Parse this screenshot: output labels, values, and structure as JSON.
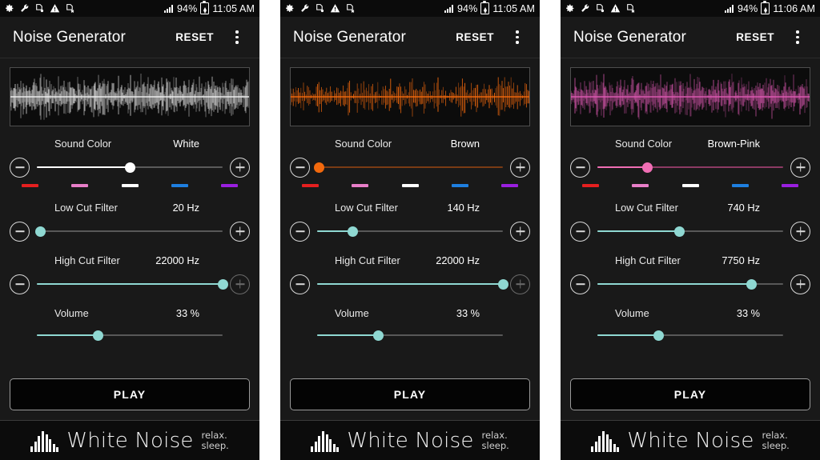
{
  "colors": {
    "accent_teal": "#8fd8d2",
    "track_off": "#585858",
    "bg_panel": "#191919",
    "bg_statusbar": "#0b0b0b",
    "brand_bar": "#0c0c0c",
    "sound_white": "#ffffff",
    "sound_brown": "#f2690d",
    "sound_brownpink": "#f06eb4"
  },
  "swatches": [
    {
      "name": "red",
      "color": "#e51f1f",
      "pos": 6
    },
    {
      "name": "pink",
      "color": "#e87ec8",
      "pos": 28
    },
    {
      "name": "white",
      "color": "#ffffff",
      "pos": 50
    },
    {
      "name": "blue",
      "color": "#1e7fe0",
      "pos": 72
    },
    {
      "name": "violet",
      "color": "#9a1fe0",
      "pos": 94
    }
  ],
  "labels": {
    "sound_color": "Sound Color",
    "low_cut": "Low Cut Filter",
    "high_cut": "High Cut Filter",
    "volume": "Volume",
    "play": "PLAY",
    "reset": "RESET",
    "app_title": "Noise Generator"
  },
  "brand": {
    "name": "White Noise",
    "tag_line1": "relax.",
    "tag_line2": "sleep."
  },
  "status_icons": [
    "gear-icon",
    "wrench-icon",
    "document-sync-icon",
    "warning-triangle-icon",
    "document-error-icon"
  ],
  "panels": [
    {
      "status": {
        "battery_pct": "94%",
        "time": "11:05 AM"
      },
      "title": "Noise Generator",
      "reset": "RESET",
      "waveform": {
        "color": "#f2f2f2",
        "seed": 11,
        "density": 1.0,
        "amp": 0.72,
        "smooth": 1
      },
      "sound_color": {
        "label": "Sound Color",
        "value": "White",
        "pos": 50,
        "fill_color": "#ffffff",
        "thumb_color": "#ffffff",
        "track_color": "#5a5a5a",
        "minus_enabled": true,
        "plus_enabled": true
      },
      "low_cut": {
        "label": "Low Cut Filter",
        "value": "20 Hz",
        "pos": 2,
        "minus_enabled": true,
        "plus_enabled": true
      },
      "high_cut": {
        "label": "High Cut Filter",
        "value": "22000 Hz",
        "pos": 100,
        "minus_enabled": true,
        "plus_enabled": false
      },
      "volume": {
        "label": "Volume",
        "value": "33 %",
        "pos": 33
      },
      "play": "PLAY"
    },
    {
      "status": {
        "battery_pct": "94%",
        "time": "11:05 AM"
      },
      "title": "Noise Generator",
      "reset": "RESET",
      "waveform": {
        "color": "#f2690d",
        "seed": 29,
        "density": 0.55,
        "amp": 0.62,
        "smooth": 2
      },
      "sound_color": {
        "label": "Sound Color",
        "value": "Brown",
        "pos": 1,
        "fill_color": "#f2690d",
        "thumb_color": "#f2690d",
        "track_color": "#7a3b14",
        "minus_enabled": true,
        "plus_enabled": true
      },
      "low_cut": {
        "label": "Low Cut Filter",
        "value": "140 Hz",
        "pos": 19,
        "minus_enabled": true,
        "plus_enabled": true
      },
      "high_cut": {
        "label": "High Cut Filter",
        "value": "22000 Hz",
        "pos": 100,
        "minus_enabled": true,
        "plus_enabled": false
      },
      "volume": {
        "label": "Volume",
        "value": "33 %",
        "pos": 33
      },
      "play": "PLAY"
    },
    {
      "status": {
        "battery_pct": "94%",
        "time": "11:06 AM"
      },
      "title": "Noise Generator",
      "reset": "RESET",
      "waveform": {
        "color": "#e05ab4",
        "seed": 47,
        "density": 0.85,
        "amp": 0.7,
        "smooth": 1
      },
      "sound_color": {
        "label": "Sound Color",
        "value": "Brown-Pink",
        "pos": 27,
        "fill_color": "#f06eb4",
        "thumb_color": "#f06eb4",
        "track_color": "#8c3a63",
        "minus_enabled": true,
        "plus_enabled": true
      },
      "low_cut": {
        "label": "Low Cut Filter",
        "value": "740 Hz",
        "pos": 44,
        "minus_enabled": true,
        "plus_enabled": true
      },
      "high_cut": {
        "label": "High Cut Filter",
        "value": "7750 Hz",
        "pos": 83,
        "minus_enabled": true,
        "plus_enabled": true
      },
      "volume": {
        "label": "Volume",
        "value": "33 %",
        "pos": 33
      },
      "play": "PLAY"
    }
  ]
}
